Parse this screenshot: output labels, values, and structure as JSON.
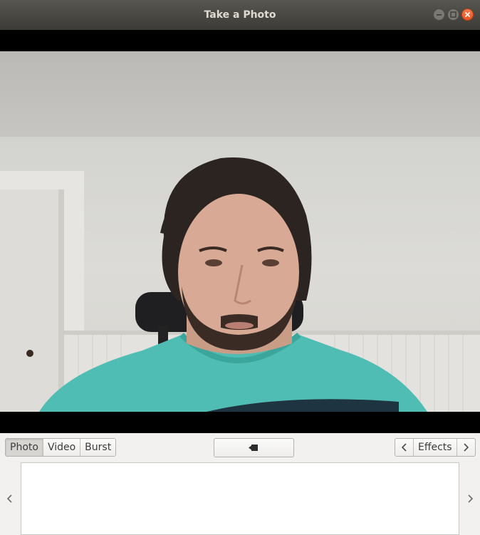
{
  "window": {
    "title": "Take a Photo",
    "controls": [
      "minimize-icon",
      "maximize-icon",
      "close-icon"
    ]
  },
  "modes": {
    "items": [
      {
        "label": "Photo",
        "active": true
      },
      {
        "label": "Video",
        "active": false
      },
      {
        "label": "Burst",
        "active": false
      }
    ]
  },
  "capture": {
    "icon": "camera-icon"
  },
  "effects": {
    "label": "Effects",
    "prev_icon": "chevron-left-icon",
    "next_icon": "chevron-right-icon"
  },
  "gallery": {
    "prev_icon": "chevron-left-icon",
    "next_icon": "chevron-right-icon"
  },
  "colors": {
    "titlebar": "#3c3b37",
    "close": "#e55523",
    "viewer_bg": "#000000",
    "wall": "#d6d5d0",
    "shirt": "#4fbdb3",
    "hair": "#2b2420"
  }
}
